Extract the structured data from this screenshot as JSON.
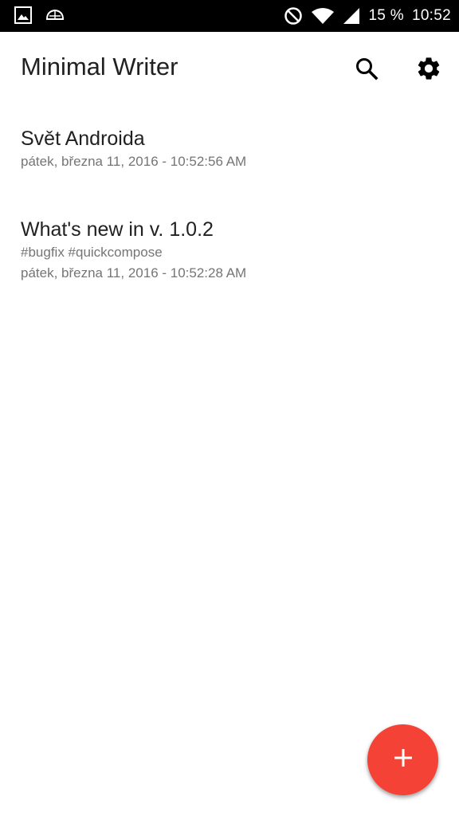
{
  "status_bar": {
    "battery_text": "15 %",
    "time": "10:52",
    "icons": [
      "image-notification-icon",
      "cloud-notification-icon",
      "do-not-disturb-icon",
      "wifi-icon",
      "cell-signal-icon"
    ]
  },
  "app_bar": {
    "title": "Minimal Writer",
    "actions": [
      "search-icon",
      "gear-icon"
    ]
  },
  "notes": [
    {
      "title": "Svět Androida",
      "tags": "",
      "date": "pátek, března 11, 2016 - 10:52:56 AM"
    },
    {
      "title": "What's new in v. 1.0.2",
      "tags": "#bugfix #quickcompose",
      "date": "pátek, března 11, 2016 - 10:52:28 AM"
    }
  ],
  "fab": {
    "icon": "plus-icon",
    "color": "#f44336"
  },
  "colors": {
    "status_bar": "#000000",
    "background": "#ffffff",
    "title_text": "#212121",
    "secondary_text": "#757575",
    "accent": "#f44336"
  }
}
